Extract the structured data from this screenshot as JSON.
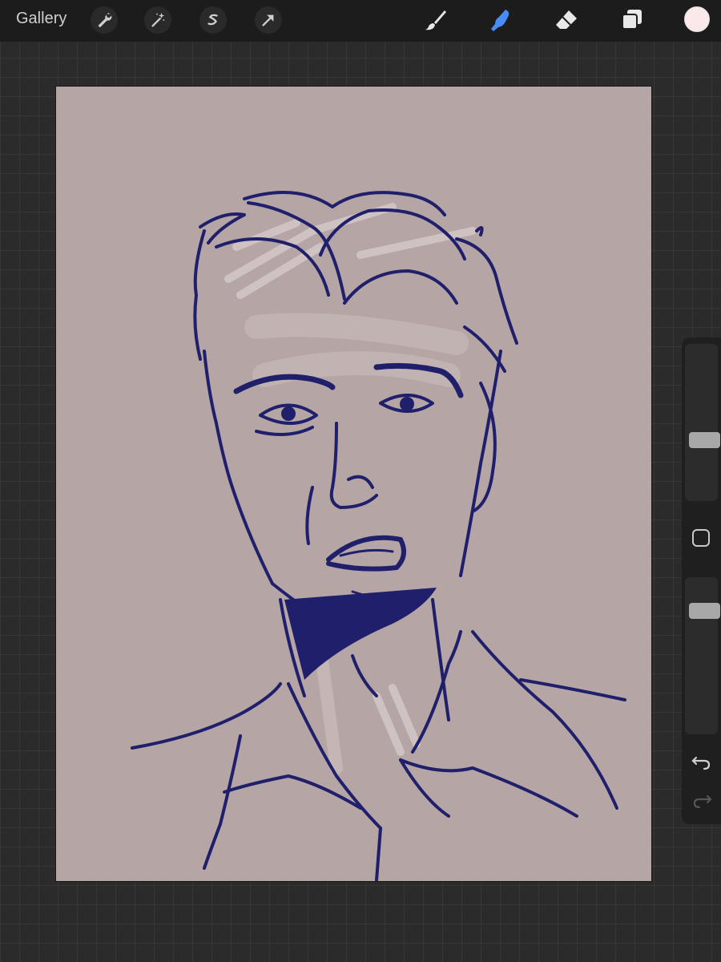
{
  "toolbar": {
    "gallery_label": "Gallery",
    "left_tools": [
      {
        "name": "actions",
        "icon": "wrench-icon"
      },
      {
        "name": "adjustments",
        "icon": "magic-wand-icon"
      },
      {
        "name": "selection",
        "icon": "selection-s-icon"
      },
      {
        "name": "transform",
        "icon": "arrow-cursor-icon"
      }
    ],
    "right_tools": [
      {
        "name": "brush",
        "icon": "paintbrush-icon"
      },
      {
        "name": "smudge",
        "icon": "smudge-finger-icon",
        "active": true
      },
      {
        "name": "eraser",
        "icon": "eraser-icon"
      },
      {
        "name": "layers",
        "icon": "layers-icon"
      }
    ],
    "current_color": "#fbe9e9",
    "active_tool_color": "#4a8cf7"
  },
  "canvas": {
    "background_color": "#b5a5a5",
    "ink_color": "#1f1f6b",
    "highlight_color": "#d8cccc"
  },
  "sidebar": {
    "brush_size_icon": "slider-thumb",
    "modify_icon": "square-icon",
    "opacity_icon": "slider-thumb",
    "undo_icon": "undo-arrow-icon",
    "redo_icon": "redo-arrow-icon"
  }
}
